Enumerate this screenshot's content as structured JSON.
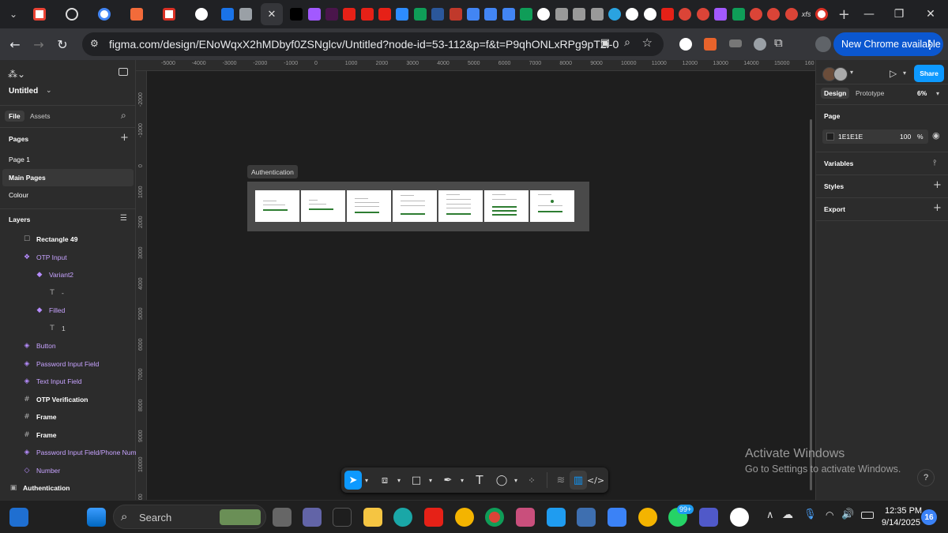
{
  "browser": {
    "tab_icons": [
      "gmail",
      "openai",
      "google",
      "app-orange",
      "app-red",
      "github",
      "media",
      "camera"
    ],
    "pinned_icons": [
      "terminal",
      "figma",
      "slack",
      "youtube",
      "youtube",
      "youtube",
      "zoom",
      "drive",
      "word",
      "cast",
      "docs",
      "docs",
      "docs",
      "sheets",
      "github",
      "app",
      "app",
      "app",
      "telegram",
      "github",
      "github",
      "youtube",
      "chrome",
      "chrome",
      "figma",
      "app-green",
      "chrome",
      "chrome",
      "chrome",
      "app",
      "xfs",
      "record"
    ],
    "tab_extra_label": "xfs",
    "url": "figma.com/design/ENoWqxX2hMDbyf0ZSNglcv/Untitled?node-id=53-112&p=f&t=P9qhONLxRPg9pT2i-0",
    "new_chrome_label": "New Chrome available"
  },
  "figma": {
    "file_name": "Untitled",
    "tabs": {
      "file": "File",
      "assets": "Assets"
    },
    "pages_heading": "Pages",
    "pages": [
      "Page 1",
      "Main Pages",
      "Colour"
    ],
    "layers_heading": "Layers",
    "layers": [
      {
        "name": "Rectangle 49",
        "icon": "rect-icon",
        "indent": 1,
        "purple": false
      },
      {
        "name": "OTP Input",
        "icon": "component-set-icon",
        "indent": 1,
        "purple": true
      },
      {
        "name": "Variant2",
        "icon": "component-icon",
        "indent": 2,
        "purple": true
      },
      {
        "name": "-",
        "icon": "text-icon",
        "indent": 3,
        "purple": false
      },
      {
        "name": "Filled",
        "icon": "component-icon",
        "indent": 2,
        "purple": true
      },
      {
        "name": "1",
        "icon": "text-icon",
        "indent": 3,
        "purple": false
      },
      {
        "name": "Button",
        "icon": "instance-icon",
        "indent": 1,
        "purple": true
      },
      {
        "name": "Password Input Field",
        "icon": "instance-icon",
        "indent": 1,
        "purple": true
      },
      {
        "name": "Text Input Field",
        "icon": "instance-icon",
        "indent": 1,
        "purple": true
      },
      {
        "name": "OTP Verification",
        "icon": "frame-icon",
        "indent": 1,
        "purple": false
      },
      {
        "name": "Frame",
        "icon": "frame-icon",
        "indent": 1,
        "purple": false
      },
      {
        "name": "Frame",
        "icon": "frame-icon",
        "indent": 1,
        "purple": false
      },
      {
        "name": "Password Input Field/Phone Numb",
        "icon": "instance-icon",
        "indent": 1,
        "purple": true
      },
      {
        "name": "Number",
        "icon": "instance-outline-icon",
        "indent": 1,
        "purple": true
      },
      {
        "name": "Authentication",
        "icon": "section-icon",
        "indent": 0,
        "purple": false
      }
    ],
    "ruler_top": [
      "-5000",
      "-4000",
      "-3000",
      "-2000",
      "-1000",
      "0",
      "1000",
      "2000",
      "3000",
      "4000",
      "5000",
      "6000",
      "7000",
      "8000",
      "9000",
      "10000",
      "11000",
      "12000",
      "13000",
      "14000",
      "15000",
      "160"
    ],
    "ruler_left": [
      "-2000",
      "-1000",
      "0",
      "1000",
      "2000",
      "3000",
      "4000",
      "5000",
      "6000",
      "7000",
      "8000",
      "9000",
      "10000",
      "000"
    ],
    "section_label": "Authentication",
    "screens_count_note": "",
    "right": {
      "tabs": {
        "design": "Design",
        "prototype": "Prototype"
      },
      "zoom": "6%",
      "share_label": "Share",
      "page_heading": "Page",
      "page_color": "1E1E1E",
      "page_opacity": "100",
      "percent": "%",
      "variables": "Variables",
      "styles": "Styles",
      "export": "Export"
    }
  },
  "windows": {
    "activate_title": "Activate Windows",
    "activate_sub": "Go to Settings to activate Windows.",
    "search_placeholder": "Search",
    "time": "12:35 PM",
    "date": "9/14/2025",
    "notif_count": "16",
    "whatsapp_badge": "99+"
  },
  "colors": {
    "accent": "#0d99ff",
    "chrome_blue": "#0b57d0",
    "canvas": "#1E1E1E"
  }
}
